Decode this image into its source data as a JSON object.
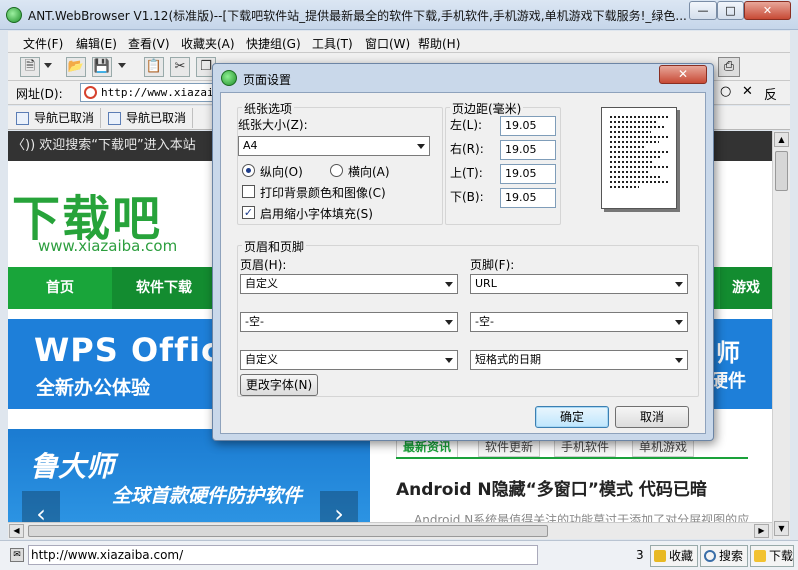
{
  "window": {
    "title": "ANT.WebBrowser V1.12(标准版)--[下载吧软件站_提供最新最全的软件下载,手机软件,手机游戏,单机游戏下载服务!_绿色..."
  },
  "menubar": {
    "items": [
      "文件(F)",
      "编辑(E)",
      "查看(V)",
      "收藏夹(A)",
      "快捷组(G)",
      "工具(T)",
      "窗口(W)",
      "帮助(H)"
    ]
  },
  "addressbar": {
    "label": "网址(D):",
    "url": "http://www.xiazaiba.com/"
  },
  "tabs": [
    "导航已取消",
    "导航已取消"
  ],
  "page": {
    "ticker": "欢迎搜索“下载吧”进入本站",
    "logo": "下载吧",
    "logo_domain": "www.xiazaiba.com",
    "nav": [
      "首页",
      "软件下载",
      "游戏"
    ],
    "banner1_title": "WPS Offic",
    "banner1_sub": "全新办公体验",
    "banner1_right_1": "师",
    "banner1_right_2": "硬件",
    "banner2_title": "鲁大师",
    "banner2_sub": "全球首款硬件防护软件",
    "news_tabs": [
      "最新资讯",
      "软件更新",
      "手机软件",
      "单机游戏"
    ],
    "headline": "Android N隐藏“多窗口”模式 代码已暗",
    "headline_sub": "Android N系统最值得关注的功能莫过于添加了对分屏视图的应"
  },
  "statusbar": {
    "url": "http://www.xiazaiba.com/",
    "count": "3",
    "favorites": "收藏",
    "search": "搜索",
    "downloads": "下载"
  },
  "dialog": {
    "title": "页面设置",
    "paper_group": "纸张选项",
    "paper_size_label": "纸张大小(Z):",
    "paper_size": "A4",
    "portrait_label": "纵向(O)",
    "landscape_label": "横向(A)",
    "orientation": "portrait",
    "print_bg_label": "打印背景颜色和图像(C)",
    "print_bg_checked": false,
    "shrink_label": "启用缩小字体填充(S)",
    "shrink_checked": true,
    "margins_group": "页边距(毫米)",
    "margin_left_label": "左(L):",
    "margin_left": "19.05",
    "margin_right_label": "右(R):",
    "margin_right": "19.05",
    "margin_top_label": "上(T):",
    "margin_top": "19.05",
    "margin_bottom_label": "下(B):",
    "margin_bottom": "19.05",
    "hf_group": "页眉和页脚",
    "header_label": "页眉(H):",
    "footer_label": "页脚(F):",
    "header_1": "自定义",
    "footer_1": "URL",
    "header_2": "-空-",
    "footer_2": "-空-",
    "header_3": "自定义",
    "footer_3": "短格式的日期",
    "font_button": "更改字体(N)",
    "ok": "确定",
    "cancel": "取消"
  },
  "colors": {
    "accent_green": "#19a53a",
    "banner_blue": "#1e7fd9",
    "close_red": "#c74a35"
  }
}
